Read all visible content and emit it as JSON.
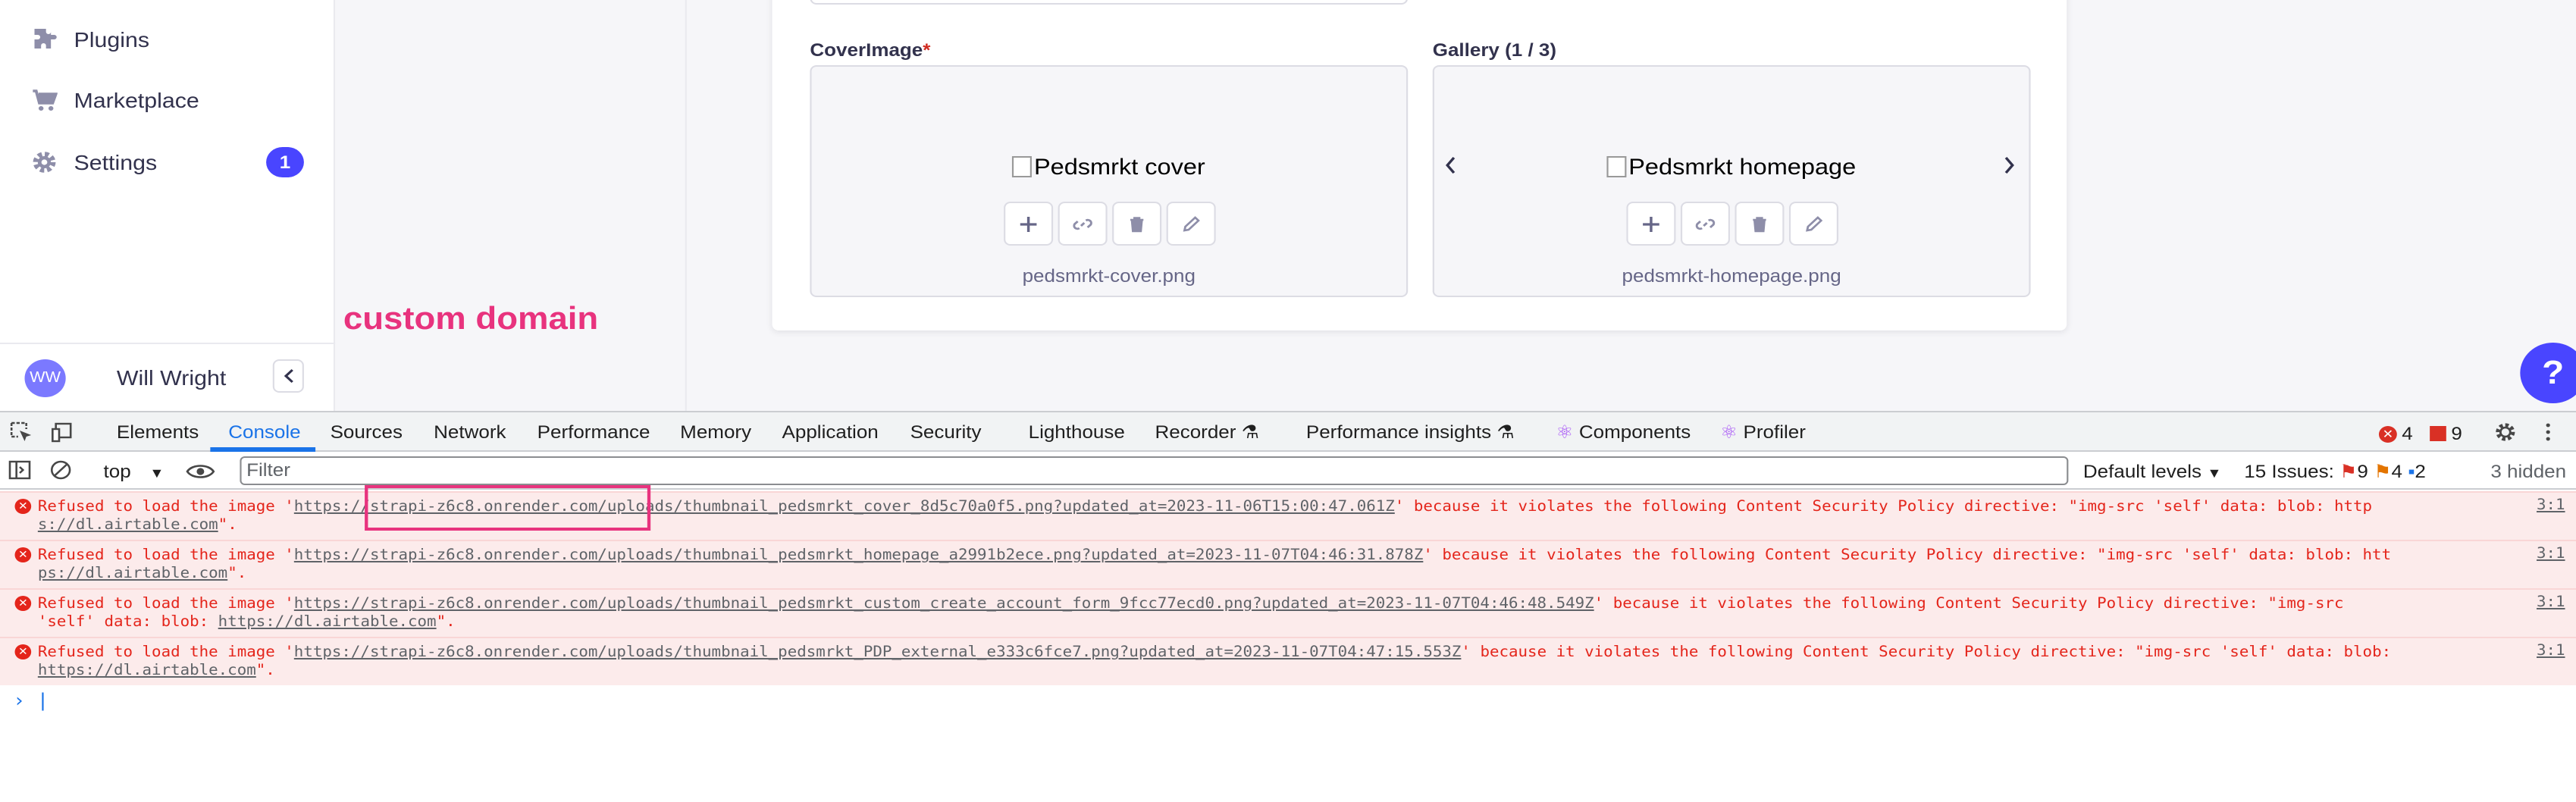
{
  "sidebar": {
    "items": [
      {
        "label": "Plugins",
        "icon": "puzzle-icon"
      },
      {
        "label": "Marketplace",
        "icon": "cart-icon"
      },
      {
        "label": "Settings",
        "icon": "gear-icon",
        "badge": "1"
      }
    ],
    "user": {
      "initials": "WW",
      "name": "Will Wright"
    }
  },
  "annotation": "custom domain",
  "form": {
    "cover": {
      "label": "CoverImage",
      "required_mark": "*",
      "alt": "Pedsmrkt cover",
      "filename": "pedsmrkt-cover.png"
    },
    "gallery": {
      "label": "Gallery (1 / 3)",
      "alt": "Pedsmrkt homepage",
      "filename": "pedsmrkt-homepage.png"
    }
  },
  "help_label": "?",
  "devtools": {
    "tabs": [
      "Elements",
      "Console",
      "Sources",
      "Network",
      "Performance",
      "Memory",
      "Application",
      "Security",
      "Lighthouse",
      "Recorder",
      "Performance insights",
      "Components",
      "Profiler"
    ],
    "active_tab": "Console",
    "error_count": "4",
    "issue_count": "9",
    "context": "top",
    "filter_placeholder": "Filter",
    "levels": "Default levels",
    "issues_label": "15 Issues:",
    "issues_errors": "9",
    "issues_warnings": "4",
    "issues_info": "2",
    "hidden": "3 hidden",
    "logs": [
      {
        "prefix": "Refused to load the image '",
        "url": "https://strapi-z6c8.onrender.com/uploads/thumbnail_pedsmrkt_cover_8d5c70a0f5.png?updated_at=2023-11-06T15:00:47.061Z",
        "suffix": "' because it violates the following Content Security Policy directive: \"img-src 'self' data: blob: http",
        "line2_link": "s://dl.airtable.com",
        "line2_end": "\".",
        "source": "3:1"
      },
      {
        "prefix": "Refused to load the image '",
        "url": "https://strapi-z6c8.onrender.com/uploads/thumbnail_pedsmrkt_homepage_a2991b2ece.png?updated_at=2023-11-07T04:46:31.878Z",
        "suffix": "' because it violates the following Content Security Policy directive: \"img-src 'self' data: blob: htt",
        "line2_link": "ps://dl.airtable.com",
        "line2_end": "\".",
        "source": "3:1"
      },
      {
        "prefix": "Refused to load the image '",
        "url": "https://strapi-z6c8.onrender.com/uploads/thumbnail_pedsmrkt_custom_create_account_form_9fcc77ecd0.png?updated_at=2023-11-07T04:46:48.549Z",
        "suffix": "' because it violates the following Content Security Policy directive: \"img-src",
        "line2_pre": "'self' data: blob: ",
        "line2_link": "https://dl.airtable.com",
        "line2_end": "\".",
        "source": "3:1"
      },
      {
        "prefix": "Refused to load the image '",
        "url": "https://strapi-z6c8.onrender.com/uploads/thumbnail_pedsmrkt_PDP_external_e333c6fce7.png?updated_at=2023-11-07T04:47:15.553Z",
        "suffix": "' because it violates the following Content Security Policy directive: \"img-src 'self' data: blob:",
        "line2_link": "https://dl.airtable.com",
        "line2_end": "\".",
        "source": "3:1"
      }
    ]
  }
}
